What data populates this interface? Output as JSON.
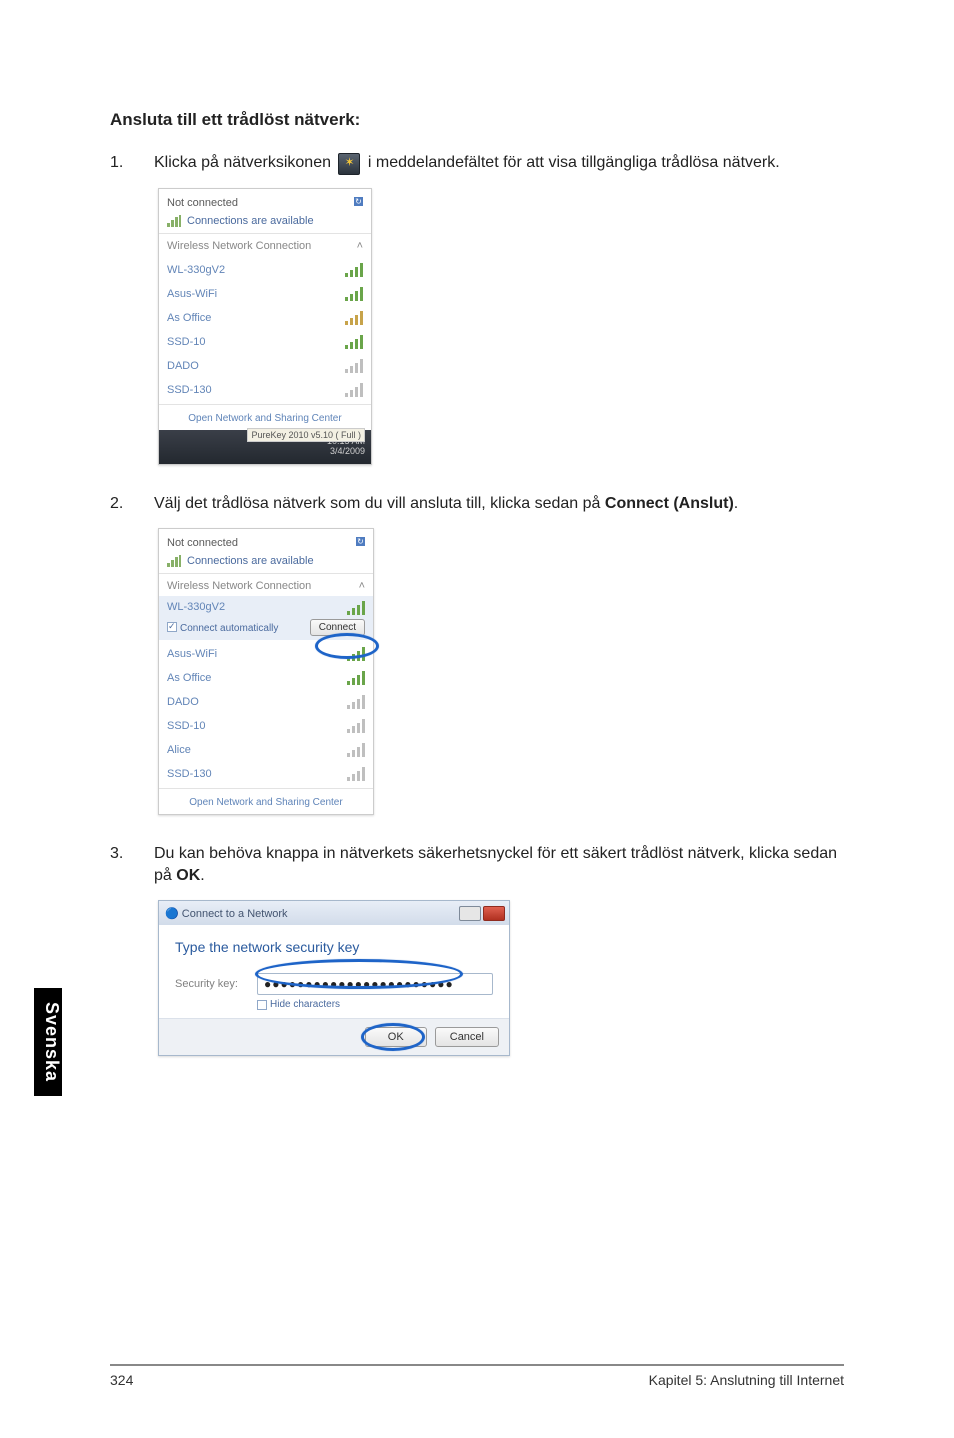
{
  "heading": "Ansluta till ett trådlöst nätverk:",
  "step1": {
    "num": "1.",
    "text_a": "Klicka på nätverksikonen ",
    "text_b": " i meddelandefältet för att visa tillgängliga trådlösa nätverk."
  },
  "step2": {
    "num": "2.",
    "text_a": "Välj det trådlösa nätverk som du vill ansluta till, klicka sedan på ",
    "bold": "Connect (Anslut)",
    "text_b": "."
  },
  "step3": {
    "num": "3.",
    "text_a": "Du kan behöva knappa in nätverkets säkerhetsnyckel för ett säkert trådlöst nätverk, klicka sedan på ",
    "bold": "OK",
    "text_b": "."
  },
  "popup_common": {
    "not_connected": "Not connected",
    "connections_available": "Connections are available",
    "wnc": "Wireless Network Connection",
    "onsc": "Open Network and Sharing Center"
  },
  "popup1": {
    "networks": [
      {
        "ssid": "WL-330gV2",
        "sig": "g"
      },
      {
        "ssid": "Asus-WiFi",
        "sig": "g"
      },
      {
        "ssid": "As Office",
        "sig": "o"
      },
      {
        "ssid": "SSD-10",
        "sig": "g"
      },
      {
        "ssid": "DADO",
        "sig": "r"
      },
      {
        "ssid": "SSD-130",
        "sig": "r"
      }
    ],
    "taskbar_tip": "PureKey 2010  v5.10 ( Full )",
    "time1": "10:15 AM",
    "time2": "3/4/2009"
  },
  "popup2": {
    "selected_ssid": "WL-330gV2",
    "checkbox_label": "Connect automatically",
    "connect_btn": "Connect",
    "networks": [
      {
        "ssid": "Asus-WiFi",
        "sig": "g"
      },
      {
        "ssid": "As Office",
        "sig": "g"
      },
      {
        "ssid": "DADO",
        "sig": "r"
      },
      {
        "ssid": "SSD-10",
        "sig": "r"
      },
      {
        "ssid": "Alice",
        "sig": "r"
      },
      {
        "ssid": "SSD-130",
        "sig": "r"
      }
    ]
  },
  "dialog3": {
    "title": "Connect to a Network",
    "instr": "Type the network security key",
    "field_label": "Security key:",
    "field_value": "●●●●●●●●●●●●●●●●●●●●●●●",
    "hide_chars": "Hide characters",
    "ok": "OK",
    "cancel": "Cancel"
  },
  "sidetab": "Svenska",
  "footer_page": "324",
  "footer_chapter": "Kapitel 5: Anslutning till Internet"
}
